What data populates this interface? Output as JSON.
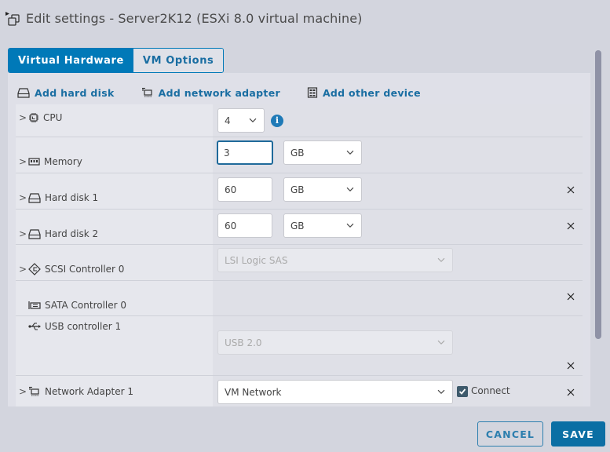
{
  "window": {
    "title": "Edit settings - Server2K12 (ESXi 8.0 virtual machine)",
    "icon": "vm-settings-icon"
  },
  "tabs": [
    {
      "label": "Virtual Hardware",
      "active": true
    },
    {
      "label": "VM Options",
      "active": false
    }
  ],
  "toolbar": {
    "add_hard_disk": "Add hard disk",
    "add_network_adapter": "Add network adapter",
    "add_other_device": "Add other device"
  },
  "hardware": {
    "cpu": {
      "label": "CPU",
      "value": "4",
      "icon": "cpu-icon",
      "expandable": true,
      "info": "i"
    },
    "memory": {
      "label": "Memory",
      "value": "3",
      "unit": "GB",
      "icon": "memory-icon",
      "expandable": true
    },
    "hard_disk_1": {
      "label": "Hard disk 1",
      "value": "60",
      "unit": "GB",
      "icon": "hard-disk-icon",
      "expandable": true,
      "removable": true
    },
    "hard_disk_2": {
      "label": "Hard disk 2",
      "value": "60",
      "unit": "GB",
      "icon": "hard-disk-icon",
      "expandable": true,
      "removable": true
    },
    "scsi_controller_0": {
      "label": "SCSI Controller 0",
      "value": "LSI Logic SAS",
      "icon": "scsi-controller-icon",
      "expandable": true,
      "disabled": true
    },
    "sata_controller_0": {
      "label": "SATA Controller 0",
      "icon": "sata-controller-icon",
      "expandable": false,
      "removable": true
    },
    "usb_controller_1": {
      "label": "USB controller 1",
      "value": "USB 2.0",
      "icon": "usb-icon",
      "expandable": false,
      "disabled": true,
      "removable": true
    },
    "network_adapter_1": {
      "label": "Network Adapter 1",
      "value": "VM Network",
      "icon": "network-adapter-icon",
      "expandable": true,
      "removable": true,
      "connect_label": "Connect",
      "connected": true
    }
  },
  "footer": {
    "cancel": "CANCEL",
    "save": "SAVE"
  },
  "colors": {
    "accent": "#0079b8",
    "background": "#d3d5de"
  }
}
